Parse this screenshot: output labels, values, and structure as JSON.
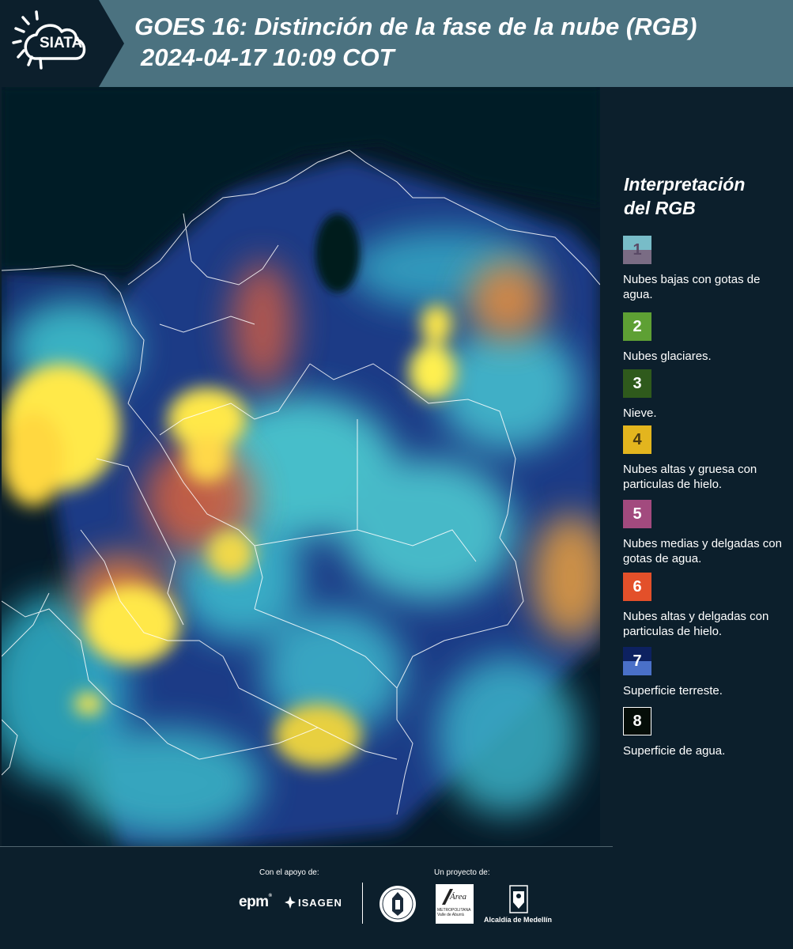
{
  "header": {
    "logo_text": "SIATA",
    "title_line1": "GOES 16: Distinción de la fase de la nube (RGB)",
    "title_line2": "2024-04-17 10:09 COT"
  },
  "legend": {
    "title_line1": "Interpretación",
    "title_line2": "del RGB",
    "items": [
      {
        "number": "1",
        "label": "Nubes bajas con gotas de agua.",
        "color_top": "#78bcc8",
        "color_bottom": "#7a6c84"
      },
      {
        "number": "2",
        "label": "Nubes glaciares.",
        "color": "#5ea034"
      },
      {
        "number": "3",
        "label": "Nieve.",
        "color": "#2f5a1c"
      },
      {
        "number": "4",
        "label": "Nubes altas y gruesa con particulas de hielo.",
        "color": "#e3b51e"
      },
      {
        "number": "5",
        "label": "Nubes medias y delgadas con gotas de agua.",
        "color": "#a24a7e"
      },
      {
        "number": "6",
        "label": "Nubes altas y delgadas con particulas de hielo.",
        "color": "#e3502a"
      },
      {
        "number": "7",
        "label": "Superficie terreste.",
        "color_top": "#0d2160",
        "color_bottom": "#4a70c8"
      },
      {
        "number": "8",
        "label": "Superficie de agua.",
        "color": "#050d08"
      }
    ]
  },
  "footer": {
    "support_label": "Con el apoyo de:",
    "project_label": "Un proyecto de:",
    "epm": "epm",
    "isagen": "ISAGEN",
    "metro_logo": "Área",
    "metro_caption": "METROPOLITANA Valle de Aburrá",
    "alcaldia": "Alcaldía de Medellín"
  },
  "colors": {
    "header_bg": "#4b7280",
    "panel_bg": "#0c1f2c",
    "cloud_yellow": "#ffe94a",
    "cloud_cyan": "#4ed8d8",
    "land_blue": "#1d3f8a",
    "water_dark": "#061a28"
  }
}
